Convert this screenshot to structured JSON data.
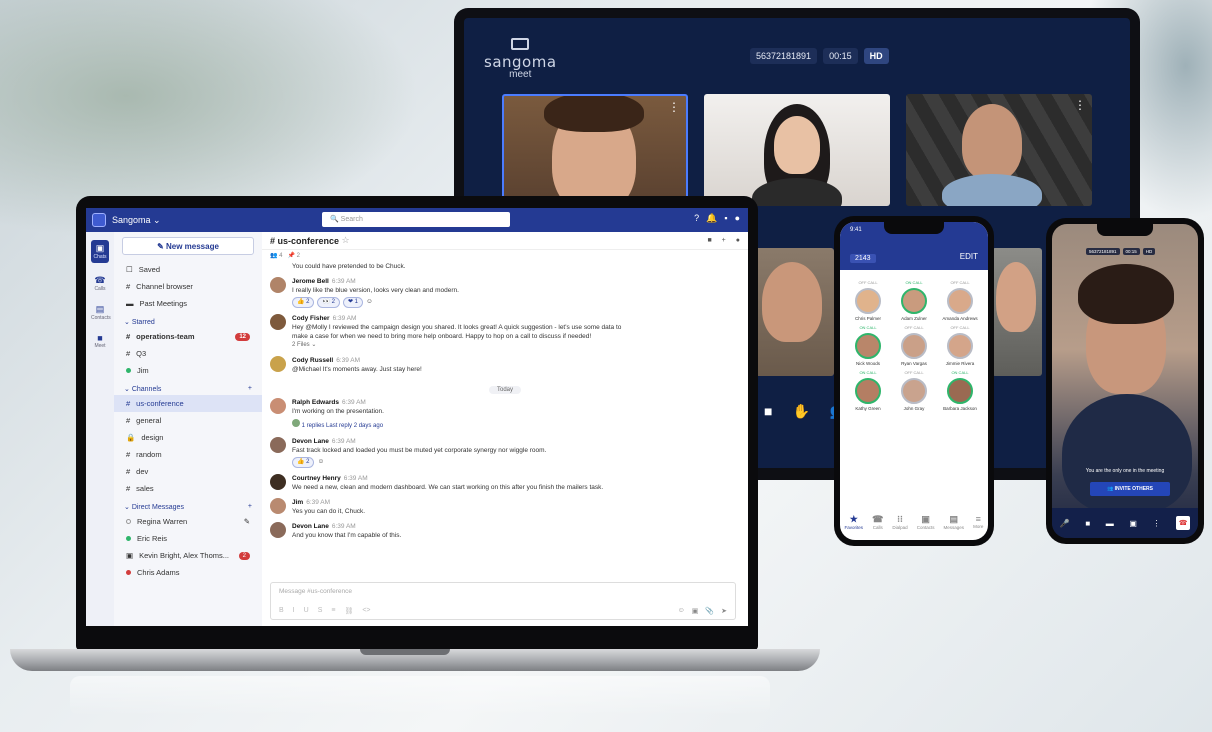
{
  "meet": {
    "brand": "sangoma",
    "brand_sub": "meet",
    "meeting_id": "56372181891",
    "timer": "00:15",
    "quality": "HD"
  },
  "app": {
    "name": "Sangoma",
    "search_placeholder": "Search"
  },
  "rail": [
    {
      "label": "Chats",
      "icon": "chat-icon"
    },
    {
      "label": "Calls",
      "icon": "phone-icon"
    },
    {
      "label": "Contacts",
      "icon": "contacts-icon"
    },
    {
      "label": "Meet",
      "icon": "video-icon"
    }
  ],
  "sidebar": {
    "new_message": "New message",
    "items": [
      {
        "label": "Saved"
      },
      {
        "label": "Channel browser"
      },
      {
        "label": "Past Meetings"
      }
    ],
    "starred_label": "Starred",
    "starred": [
      {
        "label": "operations-team",
        "badge": "12"
      },
      {
        "label": "Q3"
      },
      {
        "label": "Jim"
      }
    ],
    "channels_label": "Channels",
    "channels": [
      {
        "label": "us-conference"
      },
      {
        "label": "general"
      },
      {
        "label": "design"
      },
      {
        "label": "random"
      },
      {
        "label": "dev"
      },
      {
        "label": "sales"
      }
    ],
    "dm_label": "Direct Messages",
    "dms": [
      {
        "label": "Regina Warren"
      },
      {
        "label": "Eric Reis"
      },
      {
        "label": "Kevin Bright, Alex Thoms...",
        "badge": "2"
      },
      {
        "label": "Chris Adams"
      }
    ]
  },
  "channel": {
    "name": "# us-conference",
    "members": "4",
    "pins": "2"
  },
  "messages": [
    {
      "author": "",
      "time": "",
      "text": "You could have pretended to be Chuck."
    },
    {
      "author": "Jerome Bell",
      "time": "6:39 AM",
      "text": "I really like the blue version, looks very clean and modern."
    },
    {
      "author": "Cody Fisher",
      "time": "6:39 AM",
      "text": "Hey @Molly I reviewed the campaign design you shared. It looks great! A quick suggestion - let's use some data to make a case for when we need to bring more help onboard. Happy to hop on a call to discuss if needed!",
      "files": "2 Files"
    },
    {
      "author": "Cody Russell",
      "time": "6:39 AM",
      "text": "@Michael It's moments away. Just stay here!"
    },
    {
      "author": "Ralph Edwards",
      "time": "6:39 AM",
      "text": "I'm working on the presentation.",
      "replies": "1 replies  Last reply 2 days ago"
    },
    {
      "author": "Devon Lane",
      "time": "6:39 AM",
      "text": "Fast track locked and loaded you must be muted yet corporate synergy nor wiggle room."
    },
    {
      "author": "Courtney Henry",
      "time": "6:39 AM",
      "text": "We need a new, clean and modern dashboard. We can start working on this after you finish the mailers task."
    },
    {
      "author": "Jim",
      "time": "6:39 AM",
      "text": "Yes you can do it, Chuck."
    },
    {
      "author": "Devon Lane",
      "time": "6:39 AM",
      "text": "And you know that I'm capable of this."
    }
  ],
  "today_label": "Today",
  "composer_placeholder": "Message #us-conference",
  "phone1": {
    "time": "9:41",
    "ext": "2143",
    "edit": "EDIT",
    "contacts": [
      {
        "name": "Chris Palmer",
        "status": "OFF CALL",
        "on": false
      },
      {
        "name": "Adam Zulner",
        "status": "ON CALL",
        "on": true
      },
      {
        "name": "Amanda Andrews",
        "status": "OFF CALL",
        "on": false
      },
      {
        "name": "Nick Woods",
        "status": "ON CALL",
        "on": true
      },
      {
        "name": "Ryan Vargas",
        "status": "OFF CALL",
        "on": false
      },
      {
        "name": "Jimmie Rivera",
        "status": "OFF CALL",
        "on": false
      },
      {
        "name": "Kathy Green",
        "status": "ON CALL",
        "on": true
      },
      {
        "name": "John Gray",
        "status": "OFF CALL",
        "on": false
      },
      {
        "name": "Barbara Jackson",
        "status": "ON CALL",
        "on": true
      }
    ],
    "tabs": [
      "Favorites",
      "Calls",
      "Dialpad",
      "Contacts",
      "Messages",
      "More"
    ]
  },
  "phone2": {
    "meeting_id": "56372181891",
    "timer": "00:15",
    "quality": "HD",
    "only_text": "You are the only one in the meeting",
    "invite": "INVITE OTHERS"
  },
  "colors": {
    "brand": "#243a93",
    "online": "#2fb56b",
    "badge": "#d23c3c"
  }
}
